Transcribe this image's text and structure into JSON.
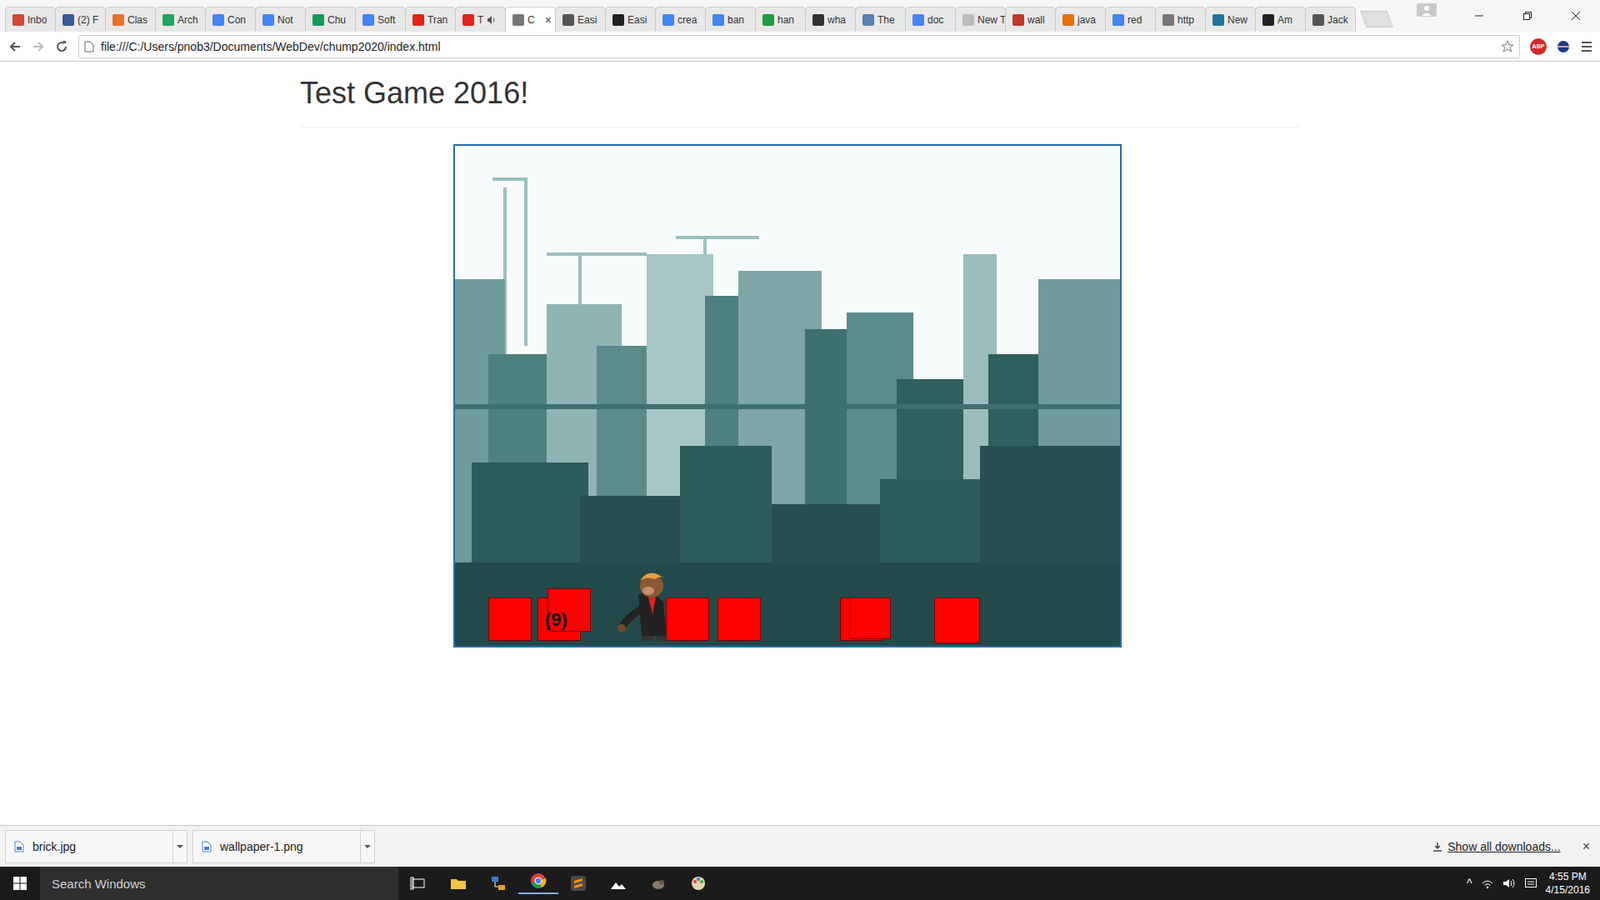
{
  "tabs": [
    {
      "label": "Inbo",
      "selected": false,
      "audio": false,
      "color": "#d44638"
    },
    {
      "label": "(2) F",
      "selected": false,
      "audio": false,
      "color": "#3b5998"
    },
    {
      "label": "Clas",
      "selected": false,
      "audio": false,
      "color": "#e8712a"
    },
    {
      "label": "Arch",
      "selected": false,
      "audio": false,
      "color": "#1fa463"
    },
    {
      "label": "Con",
      "selected": false,
      "audio": false,
      "color": "#4285f4"
    },
    {
      "label": "Not",
      "selected": false,
      "audio": false,
      "color": "#4285f4"
    },
    {
      "label": "Chu",
      "selected": false,
      "audio": false,
      "color": "#0f9d58"
    },
    {
      "label": "Soft",
      "selected": false,
      "audio": false,
      "color": "#4285f4"
    },
    {
      "label": "Tran",
      "selected": false,
      "audio": false,
      "color": "#e62117"
    },
    {
      "label": "T",
      "selected": false,
      "audio": true,
      "color": "#e62117"
    },
    {
      "label": "C",
      "selected": true,
      "audio": false,
      "color": "#777777"
    },
    {
      "label": "Easi",
      "selected": false,
      "audio": false,
      "color": "#555555"
    },
    {
      "label": "Easi",
      "selected": false,
      "audio": false,
      "color": "#222222"
    },
    {
      "label": "crea",
      "selected": false,
      "audio": false,
      "color": "#4285f4"
    },
    {
      "label": "ban",
      "selected": false,
      "audio": false,
      "color": "#4285f4"
    },
    {
      "label": "han",
      "selected": false,
      "audio": false,
      "color": "#1e9e3e"
    },
    {
      "label": "wha",
      "selected": false,
      "audio": false,
      "color": "#333333"
    },
    {
      "label": "The",
      "selected": false,
      "audio": false,
      "color": "#5a7fb5"
    },
    {
      "label": "doc",
      "selected": false,
      "audio": false,
      "color": "#4285f4"
    },
    {
      "label": "New T",
      "selected": false,
      "audio": false,
      "color": "#bbbbbb"
    },
    {
      "label": "wall",
      "selected": false,
      "audio": false,
      "color": "#c0392b"
    },
    {
      "label": "java",
      "selected": false,
      "audio": false,
      "color": "#e76f00"
    },
    {
      "label": "red",
      "selected": false,
      "audio": false,
      "color": "#4285f4"
    },
    {
      "label": "http",
      "selected": false,
      "audio": false,
      "color": "#777777"
    },
    {
      "label": "New",
      "selected": false,
      "audio": false,
      "color": "#21759b"
    },
    {
      "label": "Am",
      "selected": false,
      "audio": false,
      "color": "#222222"
    },
    {
      "label": "Jack",
      "selected": false,
      "audio": false,
      "color": "#555555"
    }
  ],
  "tab_close": "×",
  "address_bar": {
    "url": "file:///C:/Users/pnob3/Documents/WebDev/chump2020/index.html",
    "extension_badge": "ABP"
  },
  "page": {
    "heading": "Test Game 2016!",
    "game": {
      "counter": "(9)"
    }
  },
  "downloads": {
    "items": [
      {
        "name": "brick.jpg"
      },
      {
        "name": "wallpaper-1.png"
      }
    ],
    "show_all": "Show all downloads...",
    "close": "×"
  },
  "taskbar": {
    "search_placeholder": "Search Windows",
    "tray_expand": "^",
    "time": "4:55 PM",
    "date": "4/15/2016"
  }
}
